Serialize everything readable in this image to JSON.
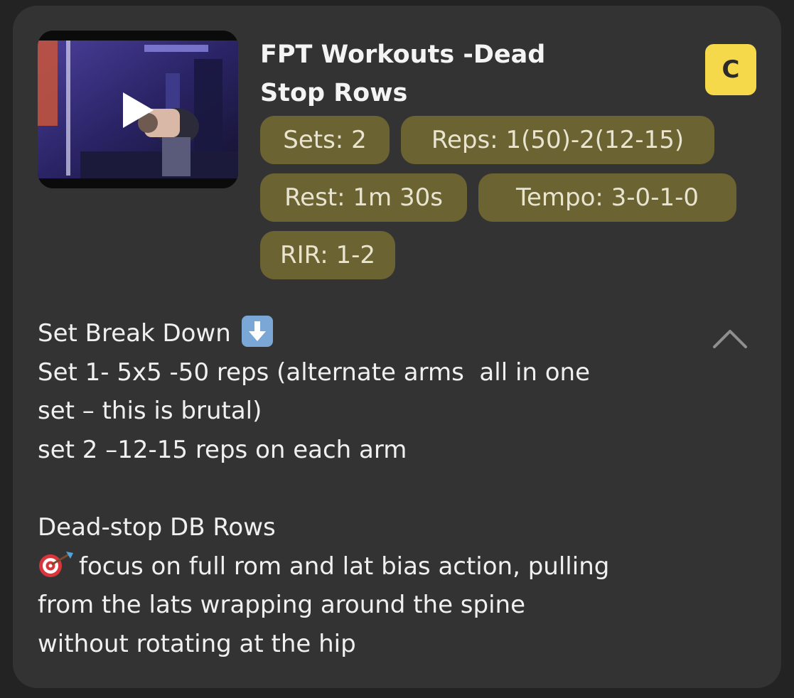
{
  "exercise": {
    "title": "FPT Workouts -Dead Stop Rows",
    "badge": "C",
    "thumbnail_icon": "play-icon"
  },
  "chips": {
    "sets": "Sets: 2",
    "reps": "Reps: 1(50)-2(12-15)",
    "rest": "Rest: 1m 30s",
    "tempo": "Tempo: 3-0-1-0",
    "rir": "RIR: 1-2"
  },
  "description": {
    "line1": "Set Break Down",
    "line1_icon": "down-arrow-emoji-icon",
    "line2": "Set 1- 5x5 -50 reps (alternate arms  all in one",
    "line3": "set – this is brutal)",
    "line4": "set 2 –12-15 reps on each arm",
    "line5": "Dead-stop DB Rows",
    "line6": "focus on full rom and lat bias action, pulling",
    "line6_icon": "target-emoji-icon",
    "line7": "from the lats wrapping around the spine",
    "line8": "without rotating at the hip"
  },
  "controls": {
    "collapse_icon": "chevron-up-icon"
  },
  "colors": {
    "card_bg": "#333333",
    "page_bg": "#232323",
    "chip_bg": "#6b6332",
    "badge_bg": "#f5d94a"
  }
}
